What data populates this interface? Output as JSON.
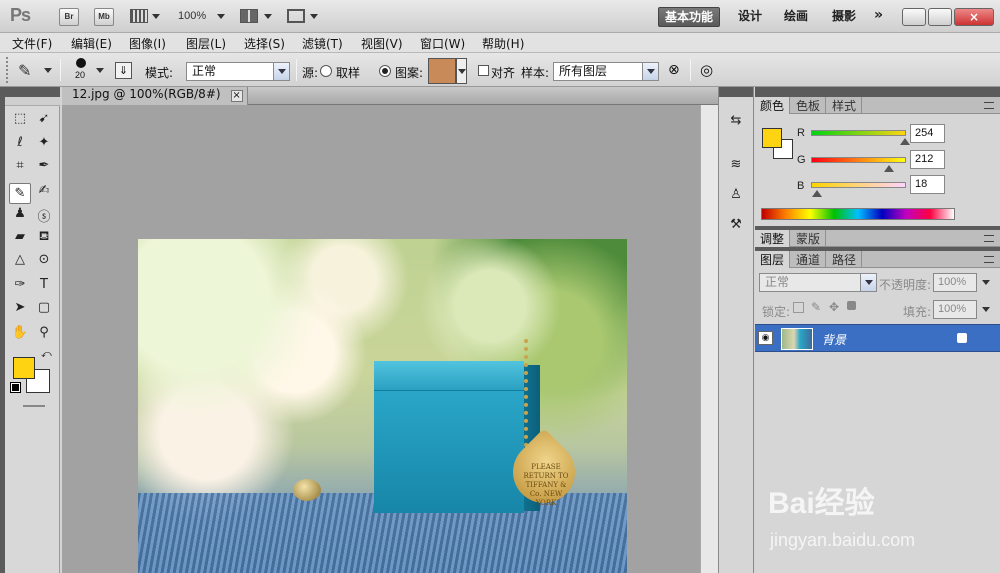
{
  "app": {
    "logo": "Ps",
    "bridge_label": "Br",
    "minibridge_label": "Mb",
    "zoom": "100%",
    "workspaces": [
      "基本功能",
      "设计",
      "绘画",
      "摄影",
      "»"
    ]
  },
  "menu": [
    "文件(F)",
    "编辑(E)",
    "图像(I)",
    "图层(L)",
    "选择(S)",
    "滤镜(T)",
    "视图(V)",
    "窗口(W)",
    "帮助(H)"
  ],
  "options": {
    "brush_size": "20",
    "mode_label": "模式:",
    "mode_value": "正常",
    "source_label": "源:",
    "radio_sampled": "取样",
    "radio_pattern": "图案:",
    "aligned_label": "对齐",
    "sample_label": "样本:",
    "sample_value": "所有图层",
    "pattern_color": "#c98a5a"
  },
  "document": {
    "tab_title": "12.jpg @ 100%(RGB/8#)",
    "close": "×",
    "photo_heart_text": "PLEASE RETURN TO TIFFANY & Co. NEW YORK"
  },
  "colors": {
    "foreground": "#fed412",
    "background": "#ffffff"
  },
  "color_panel": {
    "tabs": [
      "颜色",
      "色板",
      "样式"
    ],
    "r_label": "R",
    "g_label": "G",
    "b_label": "B",
    "r": "254",
    "g": "212",
    "b": "18"
  },
  "adjust_panel": {
    "tabs": [
      "调整",
      "蒙版"
    ]
  },
  "layers_panel": {
    "tabs": [
      "图层",
      "通道",
      "路径"
    ],
    "blend_mode": "正常",
    "opacity_label": "不透明度:",
    "opacity_value": "100%",
    "lock_label": "锁定:",
    "fill_label": "填充:",
    "fill_value": "100%",
    "layer_name": "背景"
  },
  "watermark": {
    "main": "Bai经验",
    "sub": "jingyan.baidu.com"
  }
}
